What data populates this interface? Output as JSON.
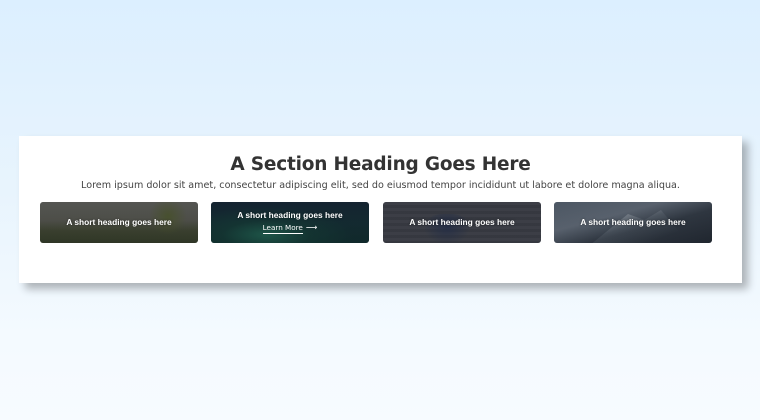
{
  "section": {
    "heading": "A Section Heading Goes Here",
    "text": "Lorem ipsum dolor sit amet, consectetur adipiscing elit, sed do eiusmod tempor incididunt ut labore et dolore magna aliqua."
  },
  "cards": [
    {
      "title": "A short heading goes here",
      "image": "lake-meadow-photo"
    },
    {
      "title": "A short heading goes here",
      "link_label": "Learn More",
      "link_icon": "arrow-right-icon",
      "image": "aurora-photo"
    },
    {
      "title": "A short heading goes here",
      "image": "people-on-boardwalk-photo"
    },
    {
      "title": "A short heading goes here",
      "image": "snowy-mountain-photo"
    }
  ]
}
